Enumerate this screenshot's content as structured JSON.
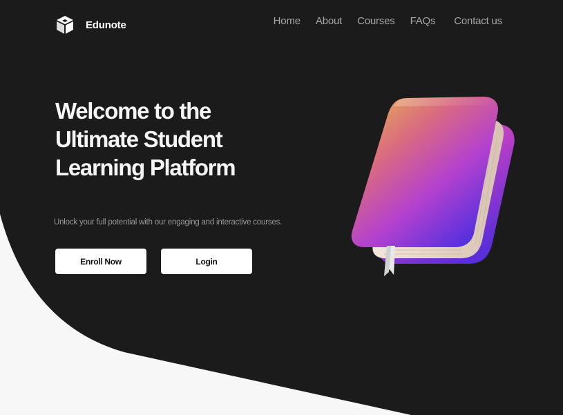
{
  "header": {
    "brand_name": "Edunote",
    "nav": [
      "Home",
      "About",
      "Courses",
      "FAQs",
      "Contact us"
    ]
  },
  "hero": {
    "title_lines": [
      "Welcome to the",
      "Ultimate Student",
      "Learning Platform"
    ],
    "subtitle": "Unlock your full potential with our engaging and interactive courses.",
    "enroll_label": "Enroll Now",
    "login_label": "Login"
  },
  "icons": {
    "logo": "edunote-logo-icon",
    "illustration": "book-icon"
  },
  "colors": {
    "background_dark": "#1b1b1b",
    "background_light": "#f7f7f7",
    "text_primary": "#f5f5f5",
    "text_muted": "#a6a6a6",
    "button_bg": "#ffffff",
    "book_gradient": [
      "#e6b24e",
      "#d8607e",
      "#b43fd0",
      "#5a2fe0"
    ]
  }
}
